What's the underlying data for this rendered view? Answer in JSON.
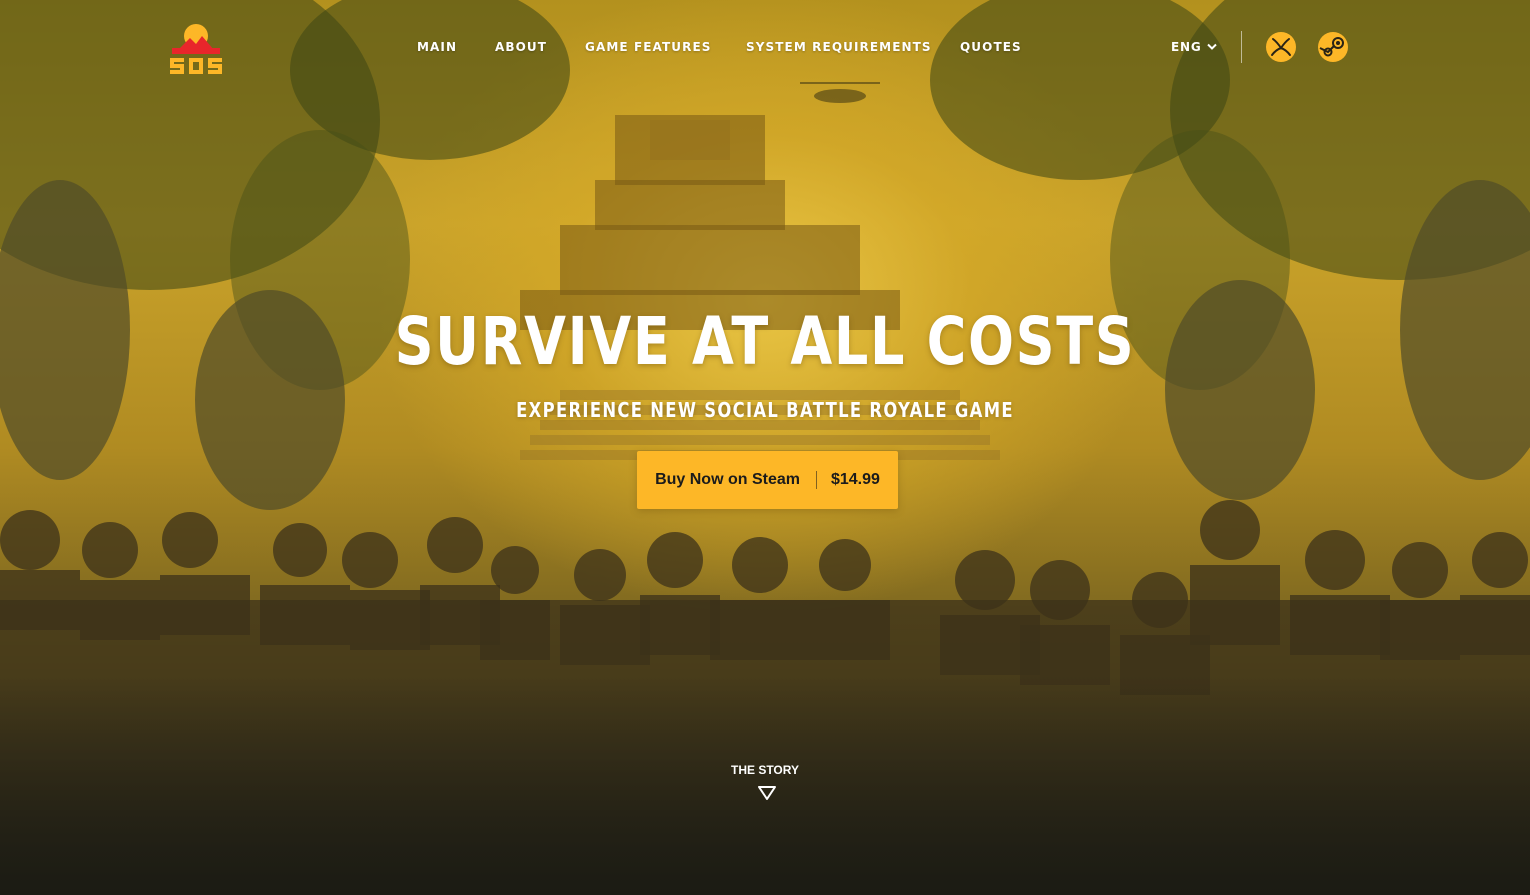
{
  "brand": {
    "logo_text": "SOS",
    "logo_color": "#fdb727",
    "logo_accent": "#e8262b"
  },
  "nav": {
    "items": [
      {
        "label": "MAIN"
      },
      {
        "label": "ABOUT"
      },
      {
        "label": "GAME FEATURES"
      },
      {
        "label": "SYSTEM REQUIREMENTS"
      },
      {
        "label": "QUOTES"
      }
    ],
    "language": "ENG",
    "platforms": [
      {
        "name": "xbox-icon"
      },
      {
        "name": "steam-icon"
      }
    ]
  },
  "hero": {
    "headline": "SURVIVE AT ALL COSTS",
    "subheadline": "EXPERIENCE NEW SOCIAL BATTLE ROYALE GAME",
    "cta": {
      "label": "Buy Now on Steam",
      "price": "$14.99"
    },
    "scroll_label": "THE STORY"
  },
  "colors": {
    "accent": "#fdb727",
    "text": "#ffffff",
    "button_text": "#1b1b1b"
  }
}
